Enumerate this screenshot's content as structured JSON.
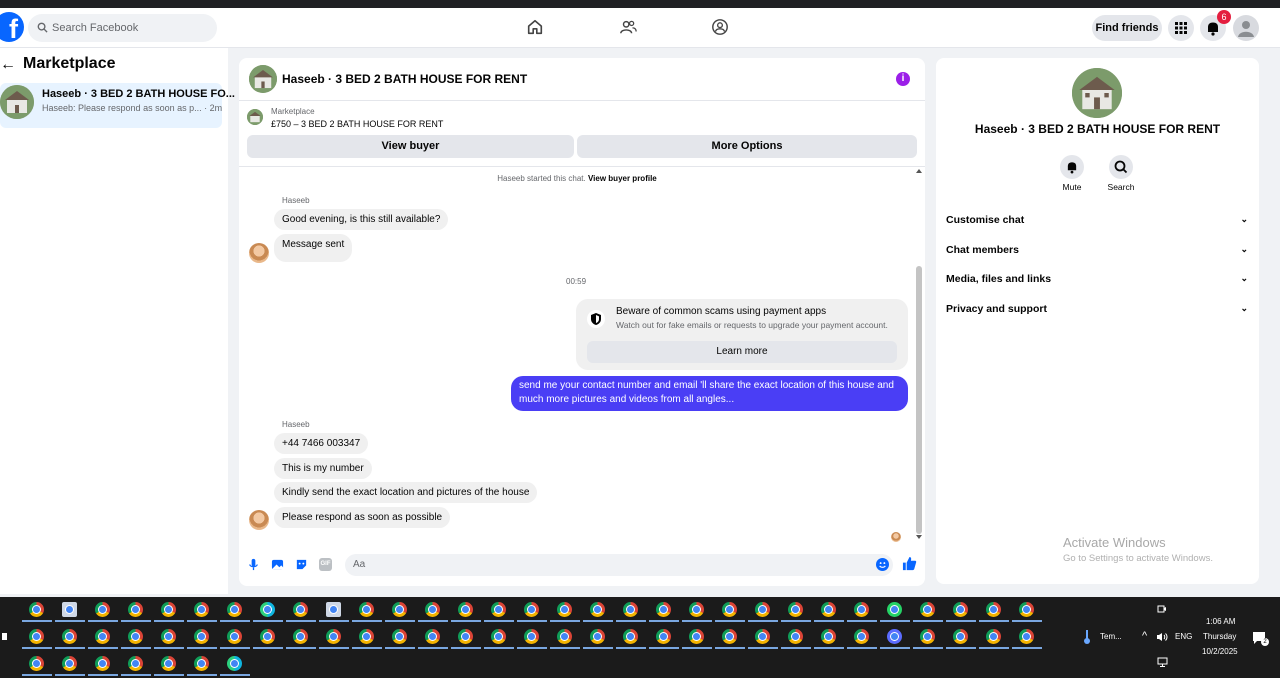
{
  "topbar": {
    "search_placeholder": "Search Facebook",
    "find_friends": "Find friends",
    "notification_count": "6",
    "logo_letter": "f"
  },
  "sidebar": {
    "back_arrow": "←",
    "title": "Marketplace",
    "conversation": {
      "title": "Haseeb · 3 BED 2 BATH HOUSE FO...",
      "preview": "Haseeb: Please respond as soon as p... · 2m"
    }
  },
  "chat": {
    "title": "Haseeb · 3 BED 2 BATH HOUSE FOR RENT",
    "info_icon": "i",
    "listing_label": "Marketplace",
    "listing_title": "£750 – 3 BED 2 BATH HOUSE FOR RENT",
    "view_buyer": "View buyer",
    "more_options": "More Options",
    "started_text": "Haseeb started this chat.",
    "view_buyer_profile": "View buyer profile",
    "sender_name": "Haseeb",
    "messages_1": [
      "Good evening, is this still available?",
      "Message sent"
    ],
    "time_label": "00:59",
    "scam_title": "Beware of common scams using payment apps",
    "scam_subtitle": "Watch out for fake emails or requests to upgrade your payment account.",
    "learn_more": "Learn more",
    "outgoing": "send me your contact number and email 'll share the exact location of this house and much more pictures and videos from all angles...",
    "messages_2": [
      "+44 7466 003347",
      "This is my number",
      "Kindly send the exact location and pictures of the house",
      "Please respond as soon as possible"
    ],
    "composer_placeholder": "Aa",
    "gif_label": "GIF"
  },
  "details": {
    "title": "Haseeb · 3 BED 2 BATH HOUSE FOR RENT",
    "mute": "Mute",
    "search": "Search",
    "sections": [
      "Customise chat",
      "Chat members",
      "Media, files and links",
      "Privacy and support"
    ],
    "chevron": "⌄"
  },
  "watermark": {
    "line1": "Activate Windows",
    "line2": "Go to Settings to activate Windows."
  },
  "tray": {
    "weather": "Tem...",
    "lang": "ENG",
    "time": "1:06 AM",
    "day": "Thursday",
    "date": "10/2/2025",
    "notif_count": "2"
  },
  "colors": {
    "accent": "#0866ff",
    "outgoing_bubble": "#4a3ef5",
    "info_purple": "#9b1fe8",
    "badge_red": "#e41e3f"
  }
}
